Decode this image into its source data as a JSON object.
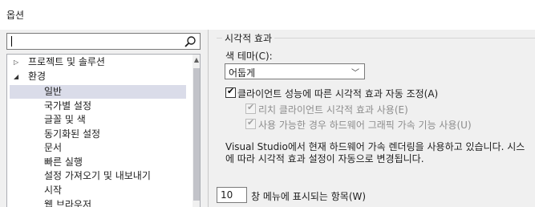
{
  "window": {
    "title": "옵션"
  },
  "search": {
    "placeholder": ""
  },
  "tree": {
    "items": [
      {
        "label": "프로젝트 및 솔루션",
        "expander": "▷"
      },
      {
        "label": "환경",
        "expander": "◢"
      },
      {
        "label": "일반",
        "selected": true
      },
      {
        "label": "국가별 설정"
      },
      {
        "label": "글꼴 및 색"
      },
      {
        "label": "동기화된 설정"
      },
      {
        "label": "문서"
      },
      {
        "label": "빠른 실행"
      },
      {
        "label": "설정 가져오기 및 내보내기"
      },
      {
        "label": "시작"
      },
      {
        "label": "웹 브라우저"
      }
    ]
  },
  "visual": {
    "group_title": "시각적 효과",
    "theme_label": "색 테마(C):",
    "theme_value": "어둡게",
    "auto_adjust_label": "클라이언트 성능에 따른 시각적 효과 자동 조정(A)",
    "auto_adjust_checked": true,
    "rich_label": "리치 클라이언트 시각적 효과 사용(E)",
    "rich_checked": true,
    "hw_label": "사용 가능한 경우 하드웨어 그래픽 가속 기능 사용(U)",
    "hw_checked": true,
    "info_line1": "Visual Studio에서 현재 하드웨어 가속 렌더링을 사용하고 있습니다. 시스",
    "info_line2": "에 따라 시각적 효과 설정이 자동으로 변경됩니다."
  },
  "window_menu": {
    "count": "10",
    "label": "창 메뉴에 표시되는 항목(W)"
  }
}
